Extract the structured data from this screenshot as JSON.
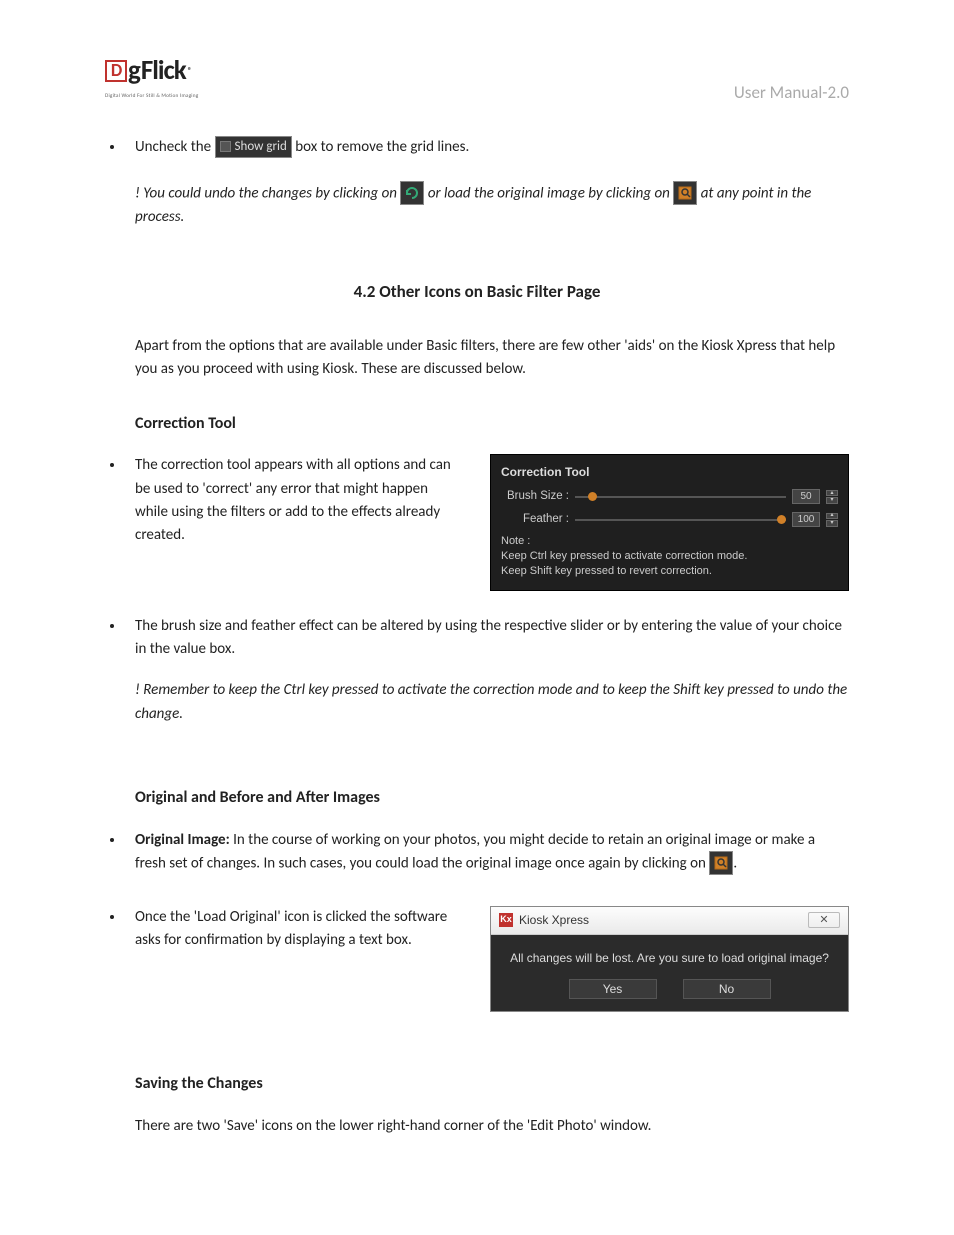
{
  "logo": {
    "letter": "D",
    "word1": "g",
    "word2": "Flick",
    "tagline": "Digital World For Still & Motion Imaging",
    "reg": "®"
  },
  "doc_title": "User Manual-2.0",
  "b1": {
    "pre": "Uncheck the ",
    "chip": "Show grid",
    "post": " box to remove the grid lines."
  },
  "note1": {
    "a": "! You could undo the changes by clicking on",
    "b": " or load the original image by clicking on ",
    "c": " at any point in the process."
  },
  "h42": "4.2 Other Icons on Basic Filter Page",
  "p42": "Apart from the options that are available under Basic filters, there are few other 'aids' on the Kiosk Xpress that help you as you proceed with using Kiosk. These are discussed below.",
  "h_ct": "Correction Tool",
  "b_ct1": "The correction tool appears with all options and can be used to 'correct' any error that might happen while using the filters or add to the effects already created.",
  "ct_panel": {
    "title": "Correction Tool",
    "brush_lbl": "Brush Size :",
    "brush_val": "50",
    "feather_lbl": "Feather :",
    "feather_val": "100",
    "note_lbl": "Note :",
    "note1": "Keep Ctrl key pressed to activate correction mode.",
    "note2": "Keep Shift key pressed to revert correction."
  },
  "b_ct2": "The brush size and feather effect can be altered by using the respective slider or by entering the value of your choice in the value box.",
  "note2": "! Remember to keep the Ctrl key pressed to activate the correction mode and to keep the Shift key pressed to undo the change.",
  "h_oba": "Original and Before and After Images",
  "b_oi": {
    "strong": "Original Image:",
    "a": " In the course of working on your photos, you might decide to retain an original image or make a fresh set of changes. In such cases, you could load the original image once again by clicking on ",
    "dot": "."
  },
  "b_lo": "Once the 'Load Original' icon is clicked the software asks for confirmation by displaying a text box.",
  "dlg": {
    "app": "Kiosk Xpress",
    "msg": "All changes will be lost. Are you sure to load original image?",
    "yes": "Yes",
    "no": "No",
    "x": "✕"
  },
  "h_save": "Saving the Changes",
  "p_save": "There are two 'Save' icons on the lower right-hand corner of the 'Edit Photo' window."
}
